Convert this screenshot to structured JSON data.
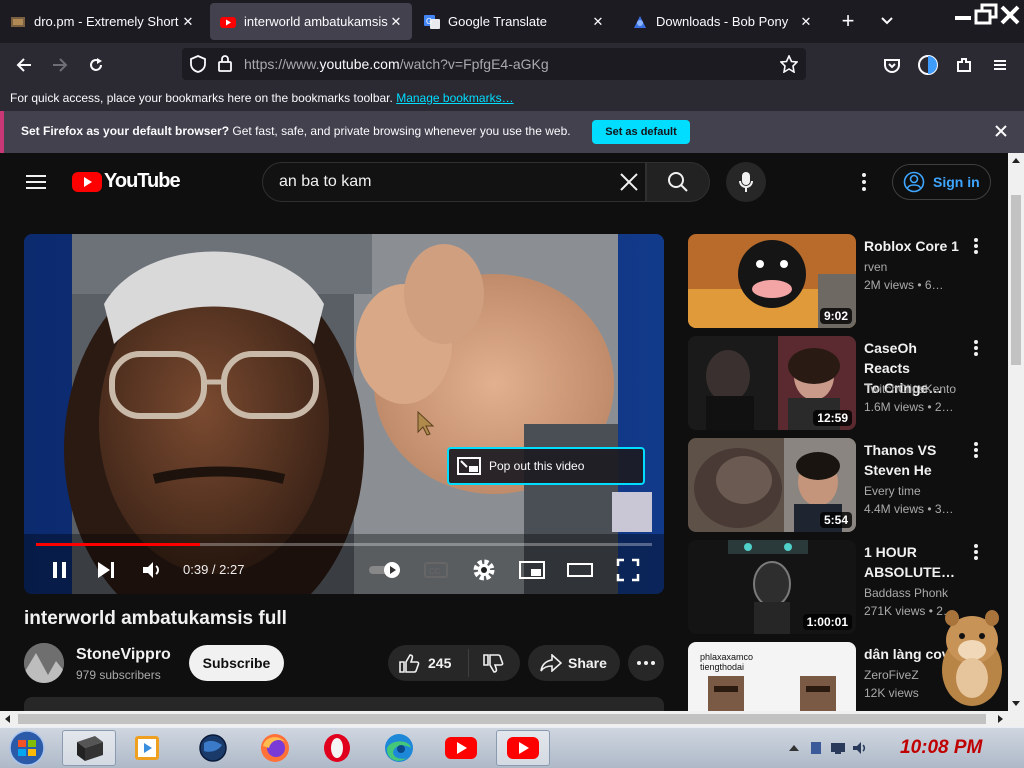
{
  "browser": {
    "tabs": [
      {
        "title": "dro.pm - Extremely Short Li",
        "active": false,
        "icon": "dro-favicon"
      },
      {
        "title": "interworld ambatukamsis f",
        "active": true,
        "icon": "youtube-favicon"
      },
      {
        "title": "Google Translate",
        "active": false,
        "icon": "google-translate-favicon"
      },
      {
        "title": "Downloads - Bob Pony",
        "active": false,
        "icon": "bobpony-favicon"
      }
    ],
    "tab_close": "✕",
    "new_tab": "+",
    "url_prefix": "https://www.",
    "url_domain": "youtube.com",
    "url_path": "/watch?v=FpfgE4-aGKg",
    "bookmarks_text": "For quick access, place your bookmarks here on the bookmarks toolbar.",
    "bookmarks_link": "Manage bookmarks…",
    "notice_bold": "Set Firefox as your default browser?",
    "notice_text": " Get fast, safe, and private browsing whenever you use the web.",
    "notice_button": "Set as default",
    "colors": {
      "accent": "#00ddff",
      "notice_stripe": "#c83877"
    }
  },
  "youtube": {
    "logo_text": "YouTube",
    "search_value": "an ba to kam",
    "signin_label": "Sign in",
    "player": {
      "progress_fraction": 0.266,
      "time_display": "0:39 / 2:27",
      "popout_label": "Pop out this video"
    },
    "video_title": "interworld ambatukamsis full",
    "channel_name": "StoneVippro",
    "subscribers": "979 subscribers",
    "subscribe_label": "Subscribe",
    "like_count": "245",
    "share_label": "Share",
    "recommendations": [
      {
        "title_lines": [
          "Roblox Core 1"
        ],
        "channel": "rven",
        "meta": "2M views  • 6…",
        "duration": "9:02"
      },
      {
        "title_lines": [
          "CaseOh Reacts",
          "To Cringe…"
        ],
        "channel": "TwitchClipsKento",
        "meta": "1.6M views  • 2…",
        "duration": "12:59"
      },
      {
        "title_lines": [
          "Thanos VS",
          "Steven He"
        ],
        "channel": "Every time",
        "meta": "4.4M views  • 3…",
        "duration": "5:54"
      },
      {
        "title_lines": [
          "1 HOUR",
          "ABSOLUTE…"
        ],
        "channel": "Baddass Phonk",
        "meta": "271K views  • 2…",
        "duration": "1:00:01"
      },
      {
        "title_lines": [
          "dân làng cove"
        ],
        "channel": "ZeroFiveZ",
        "meta": "12K views",
        "duration": "",
        "thumb_text_1": "phlaxaxamco",
        "thumb_text_2": "tiengthodai"
      }
    ]
  },
  "taskbar": {
    "clock": "10:08 PM",
    "apps": [
      "start-orb",
      "desktop-app",
      "media-center",
      "globe-app",
      "firefox",
      "opera",
      "edge",
      "youtube",
      "youtube-active"
    ]
  }
}
